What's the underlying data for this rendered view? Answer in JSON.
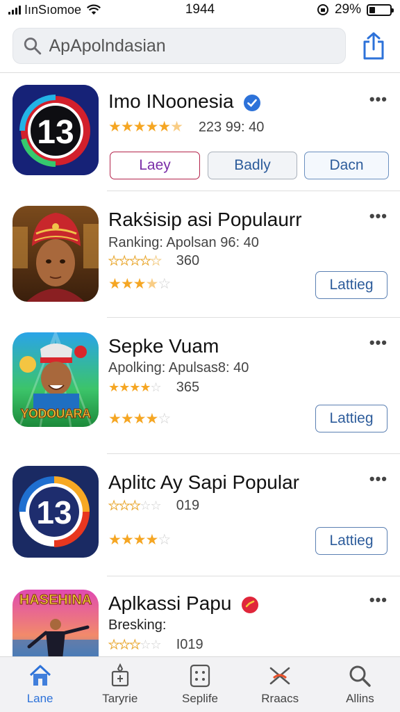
{
  "status_bar": {
    "carrier": "IınSıomoe",
    "time": "1944",
    "battery_percent": "29%",
    "battery_level": 0.29
  },
  "search": {
    "value": "ApApolndasian"
  },
  "apps": [
    {
      "title": "Imo INoonesia",
      "icon": "channel-13-logo-icon",
      "rating_text": "223 99: 40",
      "buttons": [
        "Laey",
        "Badly",
        "Dacn"
      ]
    },
    {
      "title": "Rakṡisip asi Populaurr",
      "icon": "turban-man-portrait-icon",
      "subtitle": "Ranking: Apolsan 96: 40",
      "rating_text": "360",
      "button": "Lattieg"
    },
    {
      "title": "Sepke Vuam",
      "icon": "yodouara-game-icon",
      "icon_label": "YODOUARA",
      "subtitle": "Apolking: Apulsas8: 40",
      "rating_text": "365",
      "button": "Lattieg"
    },
    {
      "title": "Aplitc Ay Sapi Popular",
      "icon": "channel-13-logo-icon",
      "rating_text": "019",
      "button": "Lattieg"
    },
    {
      "title": "Aplkassi Papu",
      "icon": "hasehina-movie-icon",
      "icon_label": "HASEHINA",
      "subtitle": "Bresking:",
      "rating_text": "I019"
    }
  ],
  "tabs": [
    {
      "label": "Lane",
      "icon": "home-icon",
      "active": true
    },
    {
      "label": "Taryrie",
      "icon": "games-icon",
      "active": false
    },
    {
      "label": "Seplife",
      "icon": "apps-icon",
      "active": false
    },
    {
      "label": "Rraacs",
      "icon": "arcade-icon",
      "active": false
    },
    {
      "label": "Allins",
      "icon": "search-icon",
      "active": false
    }
  ],
  "colors": {
    "accent": "#2d72d9",
    "star": "#f5a623",
    "verified": "#2d72d9",
    "badge_red": "#e0263a"
  }
}
